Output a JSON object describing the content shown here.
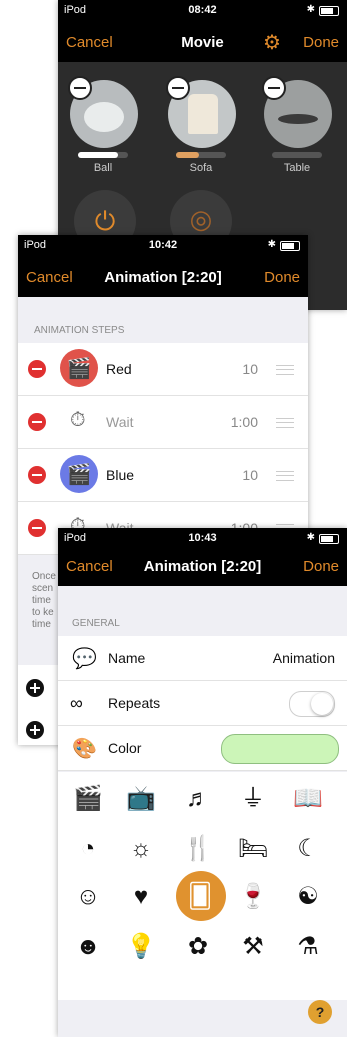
{
  "movie": {
    "status": {
      "carrier": "iPod",
      "time": "08:42"
    },
    "nav": {
      "cancel": "Cancel",
      "title": "Movie",
      "done": "Done"
    },
    "lamps": [
      {
        "label": "Ball",
        "level": 0.8
      },
      {
        "label": "Sofa",
        "level": 0.45
      },
      {
        "label": "Table",
        "level": 0.0
      }
    ],
    "icons": [
      "power-icon",
      "fingerprint-icon"
    ]
  },
  "animation_steps": {
    "status": {
      "carrier": "iPod",
      "time": "10:42"
    },
    "nav": {
      "cancel": "Cancel",
      "title": "Animation [2:20]",
      "done": "Done"
    },
    "section_header": "ANIMATION STEPS",
    "steps": [
      {
        "name": "Red",
        "value": "10",
        "icon": "scene-icon",
        "icon_bg": "#e0534a"
      },
      {
        "name": "Wait",
        "value": "1:00",
        "icon": "stopwatch-icon"
      },
      {
        "name": "Blue",
        "value": "10",
        "icon": "scene-icon",
        "icon_bg": "#6b7ae6"
      },
      {
        "name": "Wait",
        "value": "1:00",
        "icon": "stopwatch-icon"
      }
    ],
    "footer_lines": [
      "Once",
      "scen",
      "time",
      "to ke",
      "time"
    ],
    "help": "?"
  },
  "animation_settings": {
    "status": {
      "carrier": "iPod",
      "time": "10:43"
    },
    "nav": {
      "cancel": "Cancel",
      "title": "Animation [2:20]",
      "done": "Done"
    },
    "section_header": "GENERAL",
    "name_label": "Name",
    "name_value": "Animation",
    "repeats_label": "Repeats",
    "repeats_on": false,
    "color_label": "Color",
    "color_value": "#ccf5b8",
    "icon_grid": [
      [
        "scene-icon",
        "remote-icon",
        "music-icon",
        "iron-icon",
        "book-icon"
      ],
      [
        "clock-icon",
        "sun-icon",
        "dining-icon",
        "bed-icon",
        "moon-icon"
      ],
      [
        "mask-icon",
        "heart-icon",
        "cards-icon",
        "wine-icon",
        "yin-yang-icon"
      ],
      [
        "chef-icon",
        "bulb-icon",
        "plant-icon",
        "hammer-icon",
        "dumbbell-icon"
      ]
    ],
    "icon_glyphs": [
      [
        "🎬",
        "📺",
        "♬",
        "⏚",
        "📖"
      ],
      [
        "◔",
        "☼",
        "🍴",
        "🛏",
        "☾"
      ],
      [
        "☺",
        "♥",
        "🂠",
        "🍷",
        "☯"
      ],
      [
        "☻",
        "💡",
        "✿",
        "⚒",
        "⚗"
      ]
    ],
    "selected_icon": "cards-icon",
    "help": "?"
  }
}
